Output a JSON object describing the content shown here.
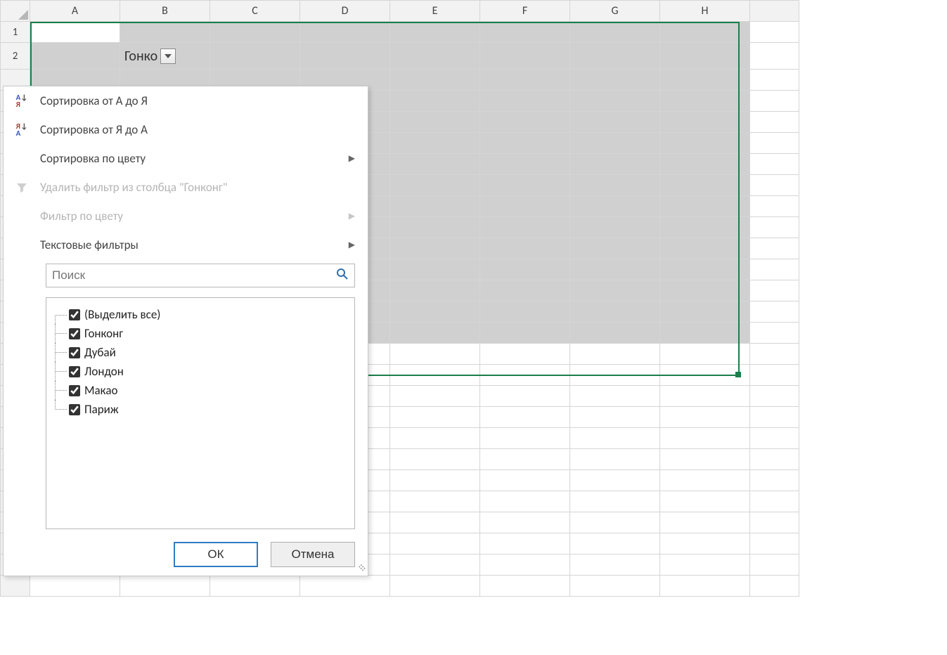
{
  "columns": [
    "A",
    "B",
    "C",
    "D",
    "E",
    "F",
    "G",
    "H",
    ""
  ],
  "rows": [
    "1",
    "2"
  ],
  "cell_b2_text": "Гонко",
  "menu": {
    "sort_asc": "Сортировка от А до Я",
    "sort_desc": "Сортировка от Я до А",
    "sort_color": "Сортировка по цвету",
    "clear_filter": "Удалить фильтр из столбца \"Гонконг\"",
    "filter_color": "Фильтр по цвету",
    "text_filters": "Текстовые фильтры"
  },
  "search": {
    "placeholder": "Поиск"
  },
  "checks": [
    {
      "label": "(Выделить все)",
      "checked": true
    },
    {
      "label": "Гонконг",
      "checked": true
    },
    {
      "label": "Дубай",
      "checked": true
    },
    {
      "label": "Лондон",
      "checked": true
    },
    {
      "label": "Макао",
      "checked": true
    },
    {
      "label": "Париж",
      "checked": true
    }
  ],
  "buttons": {
    "ok": "ОК",
    "cancel": "Отмена"
  },
  "colors": {
    "selection_border": "#1a7f4b",
    "primary_btn_border": "#2f7cc3"
  }
}
